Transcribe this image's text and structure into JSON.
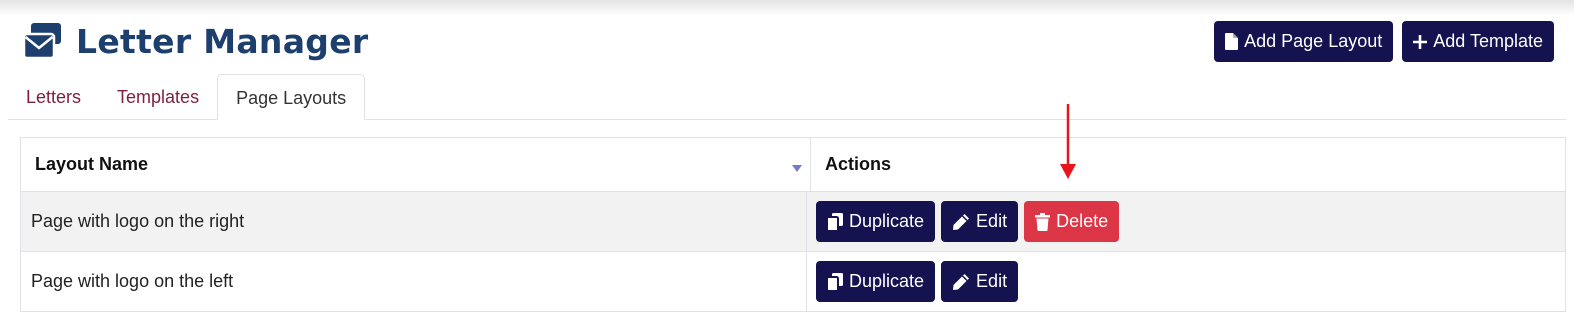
{
  "app": {
    "title": "Letter Manager",
    "logo_icon": "envelopes-icon"
  },
  "header_actions": {
    "add_page_layout_label": "Add Page Layout",
    "add_template_label": "Add Template"
  },
  "tabs": [
    {
      "label": "Letters",
      "active": false
    },
    {
      "label": "Templates",
      "active": false
    },
    {
      "label": "Page Layouts",
      "active": true
    }
  ],
  "table": {
    "columns": [
      "Layout Name",
      "Actions"
    ],
    "sort_icon": "sort-down-icon",
    "rows": [
      {
        "name": "Page with logo on the right",
        "actions": [
          "Duplicate",
          "Edit",
          "Delete"
        ]
      },
      {
        "name": "Page with logo on the left",
        "actions": [
          "Duplicate",
          "Edit"
        ]
      }
    ]
  },
  "colors": {
    "title": "#1c3f6e",
    "primary_button": "#14124f",
    "danger_button": "#dc3545",
    "tab_link": "#7d1f40",
    "annotation_arrow": "#e8141b"
  }
}
